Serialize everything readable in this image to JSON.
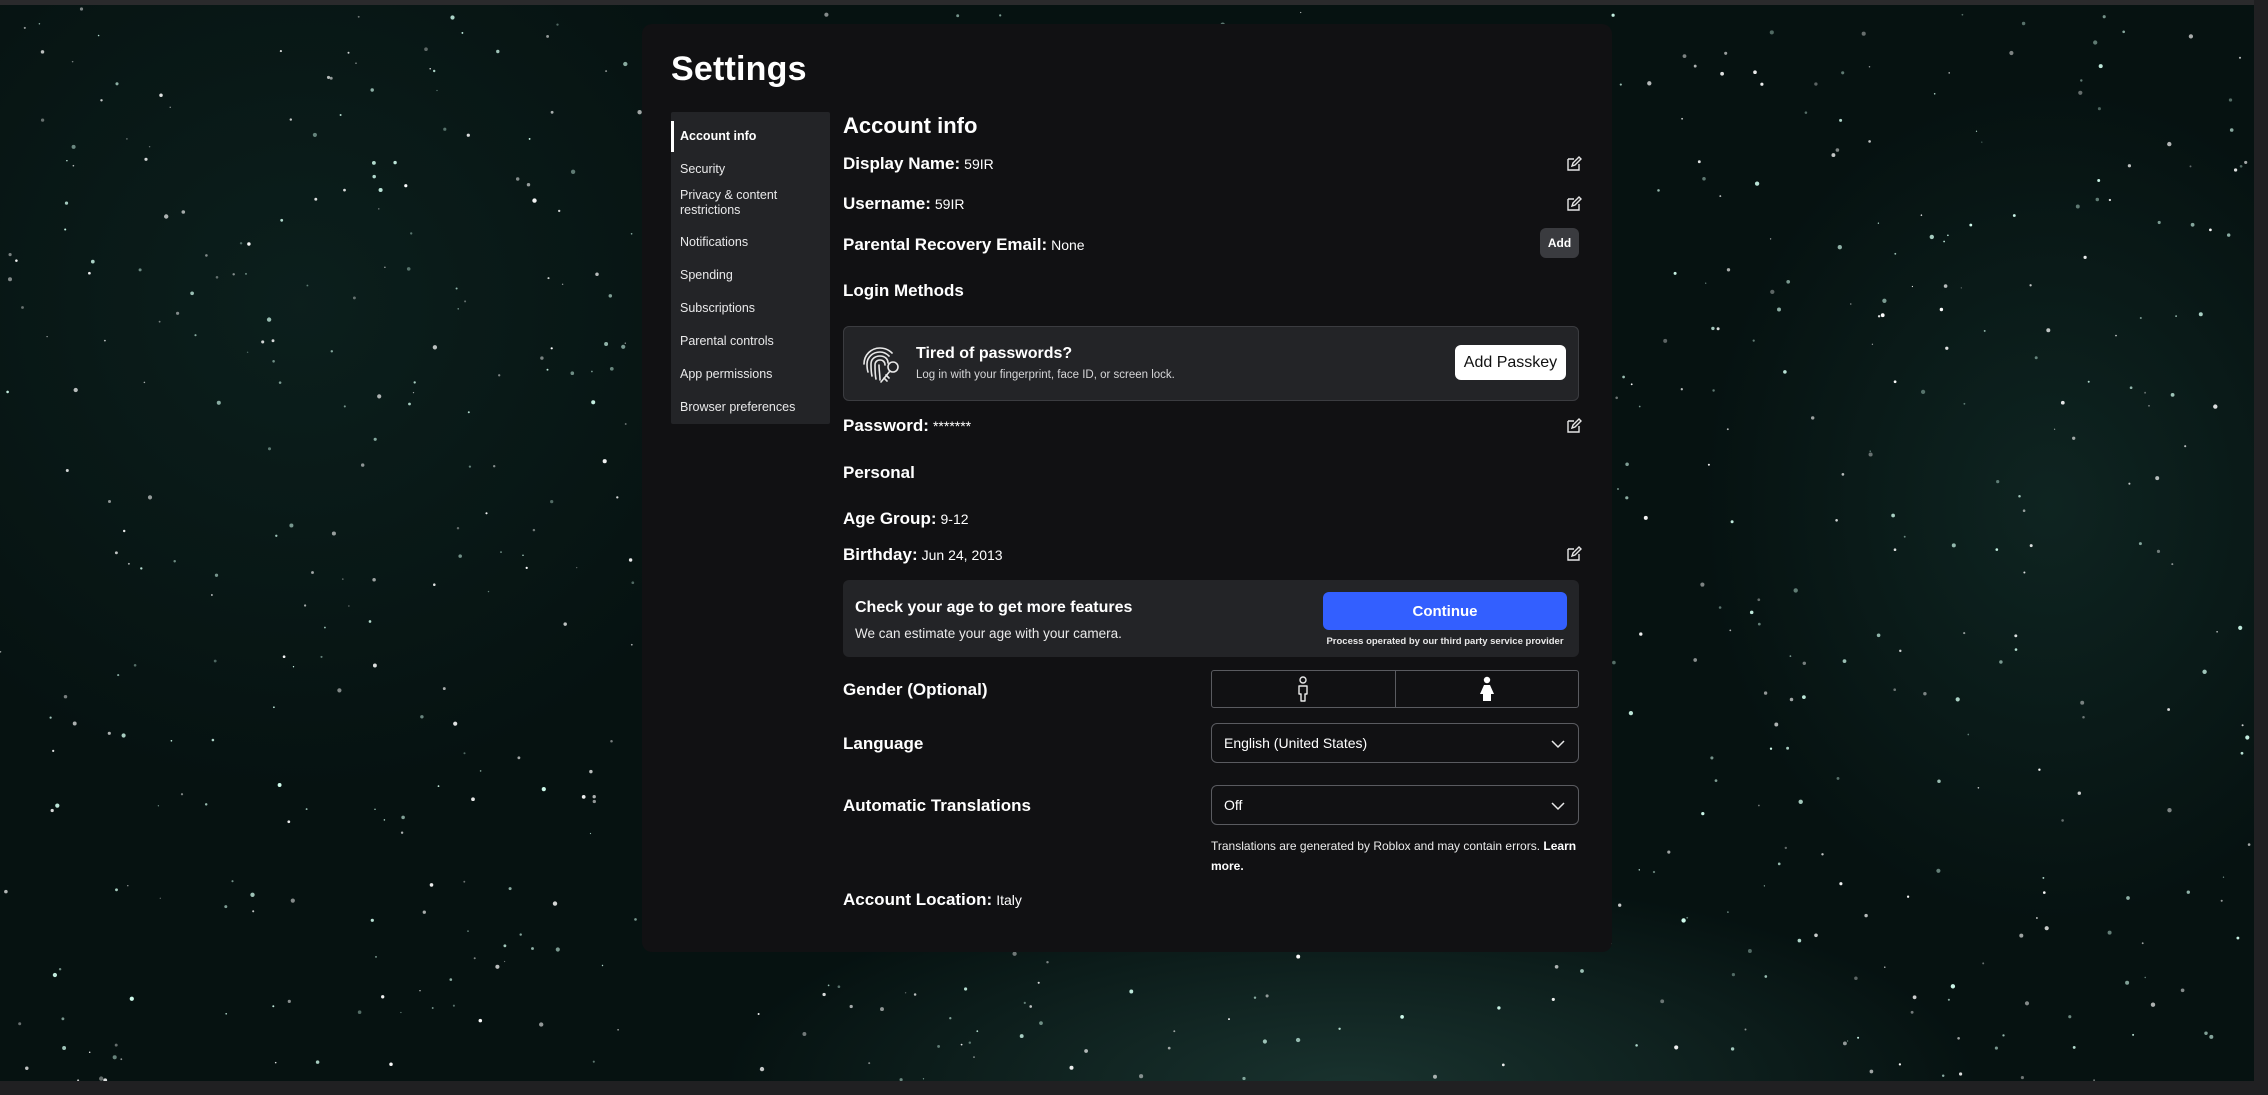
{
  "page": {
    "title": "Settings"
  },
  "sidebar": {
    "items": [
      {
        "label": "Account info",
        "active": true
      },
      {
        "label": "Security"
      },
      {
        "label": "Privacy & content restrictions"
      },
      {
        "label": "Notifications"
      },
      {
        "label": "Spending"
      },
      {
        "label": "Subscriptions"
      },
      {
        "label": "Parental controls"
      },
      {
        "label": "App permissions"
      },
      {
        "label": "Browser preferences"
      }
    ]
  },
  "account": {
    "heading": "Account info",
    "display_name": {
      "label": "Display Name:",
      "value": "59IR"
    },
    "username": {
      "label": "Username:",
      "value": "59IR"
    },
    "parental_email": {
      "label": "Parental Recovery Email:",
      "value": "None",
      "button": "Add"
    },
    "login_methods_heading": "Login Methods",
    "passkey": {
      "title": "Tired of passwords?",
      "subtitle": "Log in with your fingerprint, face ID, or screen lock.",
      "button": "Add Passkey",
      "icon": "fingerprint-key-icon"
    },
    "password": {
      "label": "Password:",
      "value": "*******"
    },
    "personal_heading": "Personal",
    "age_group": {
      "label": "Age Group:",
      "value": "9-12"
    },
    "birthday": {
      "label": "Birthday:",
      "value": "Jun 24, 2013"
    },
    "age_check": {
      "title": "Check your age to get more features",
      "subtitle": "We can estimate your age with your camera.",
      "button": "Continue",
      "note": "Process operated by our third party service provider"
    },
    "gender": {
      "label": "Gender (Optional)",
      "options": [
        "male-icon",
        "female-icon"
      ]
    },
    "language": {
      "label": "Language",
      "value": "English (United States)"
    },
    "auto_translations": {
      "label": "Automatic Translations",
      "value": "Off",
      "note": "Translations are generated by Roblox and may contain errors.",
      "learn_more": "Learn more."
    },
    "location": {
      "label": "Account Location:",
      "value": "Italy"
    }
  },
  "colors": {
    "panel": "#111113",
    "sidebar": "#232427",
    "accent": "#335fff",
    "card": "#232427"
  }
}
